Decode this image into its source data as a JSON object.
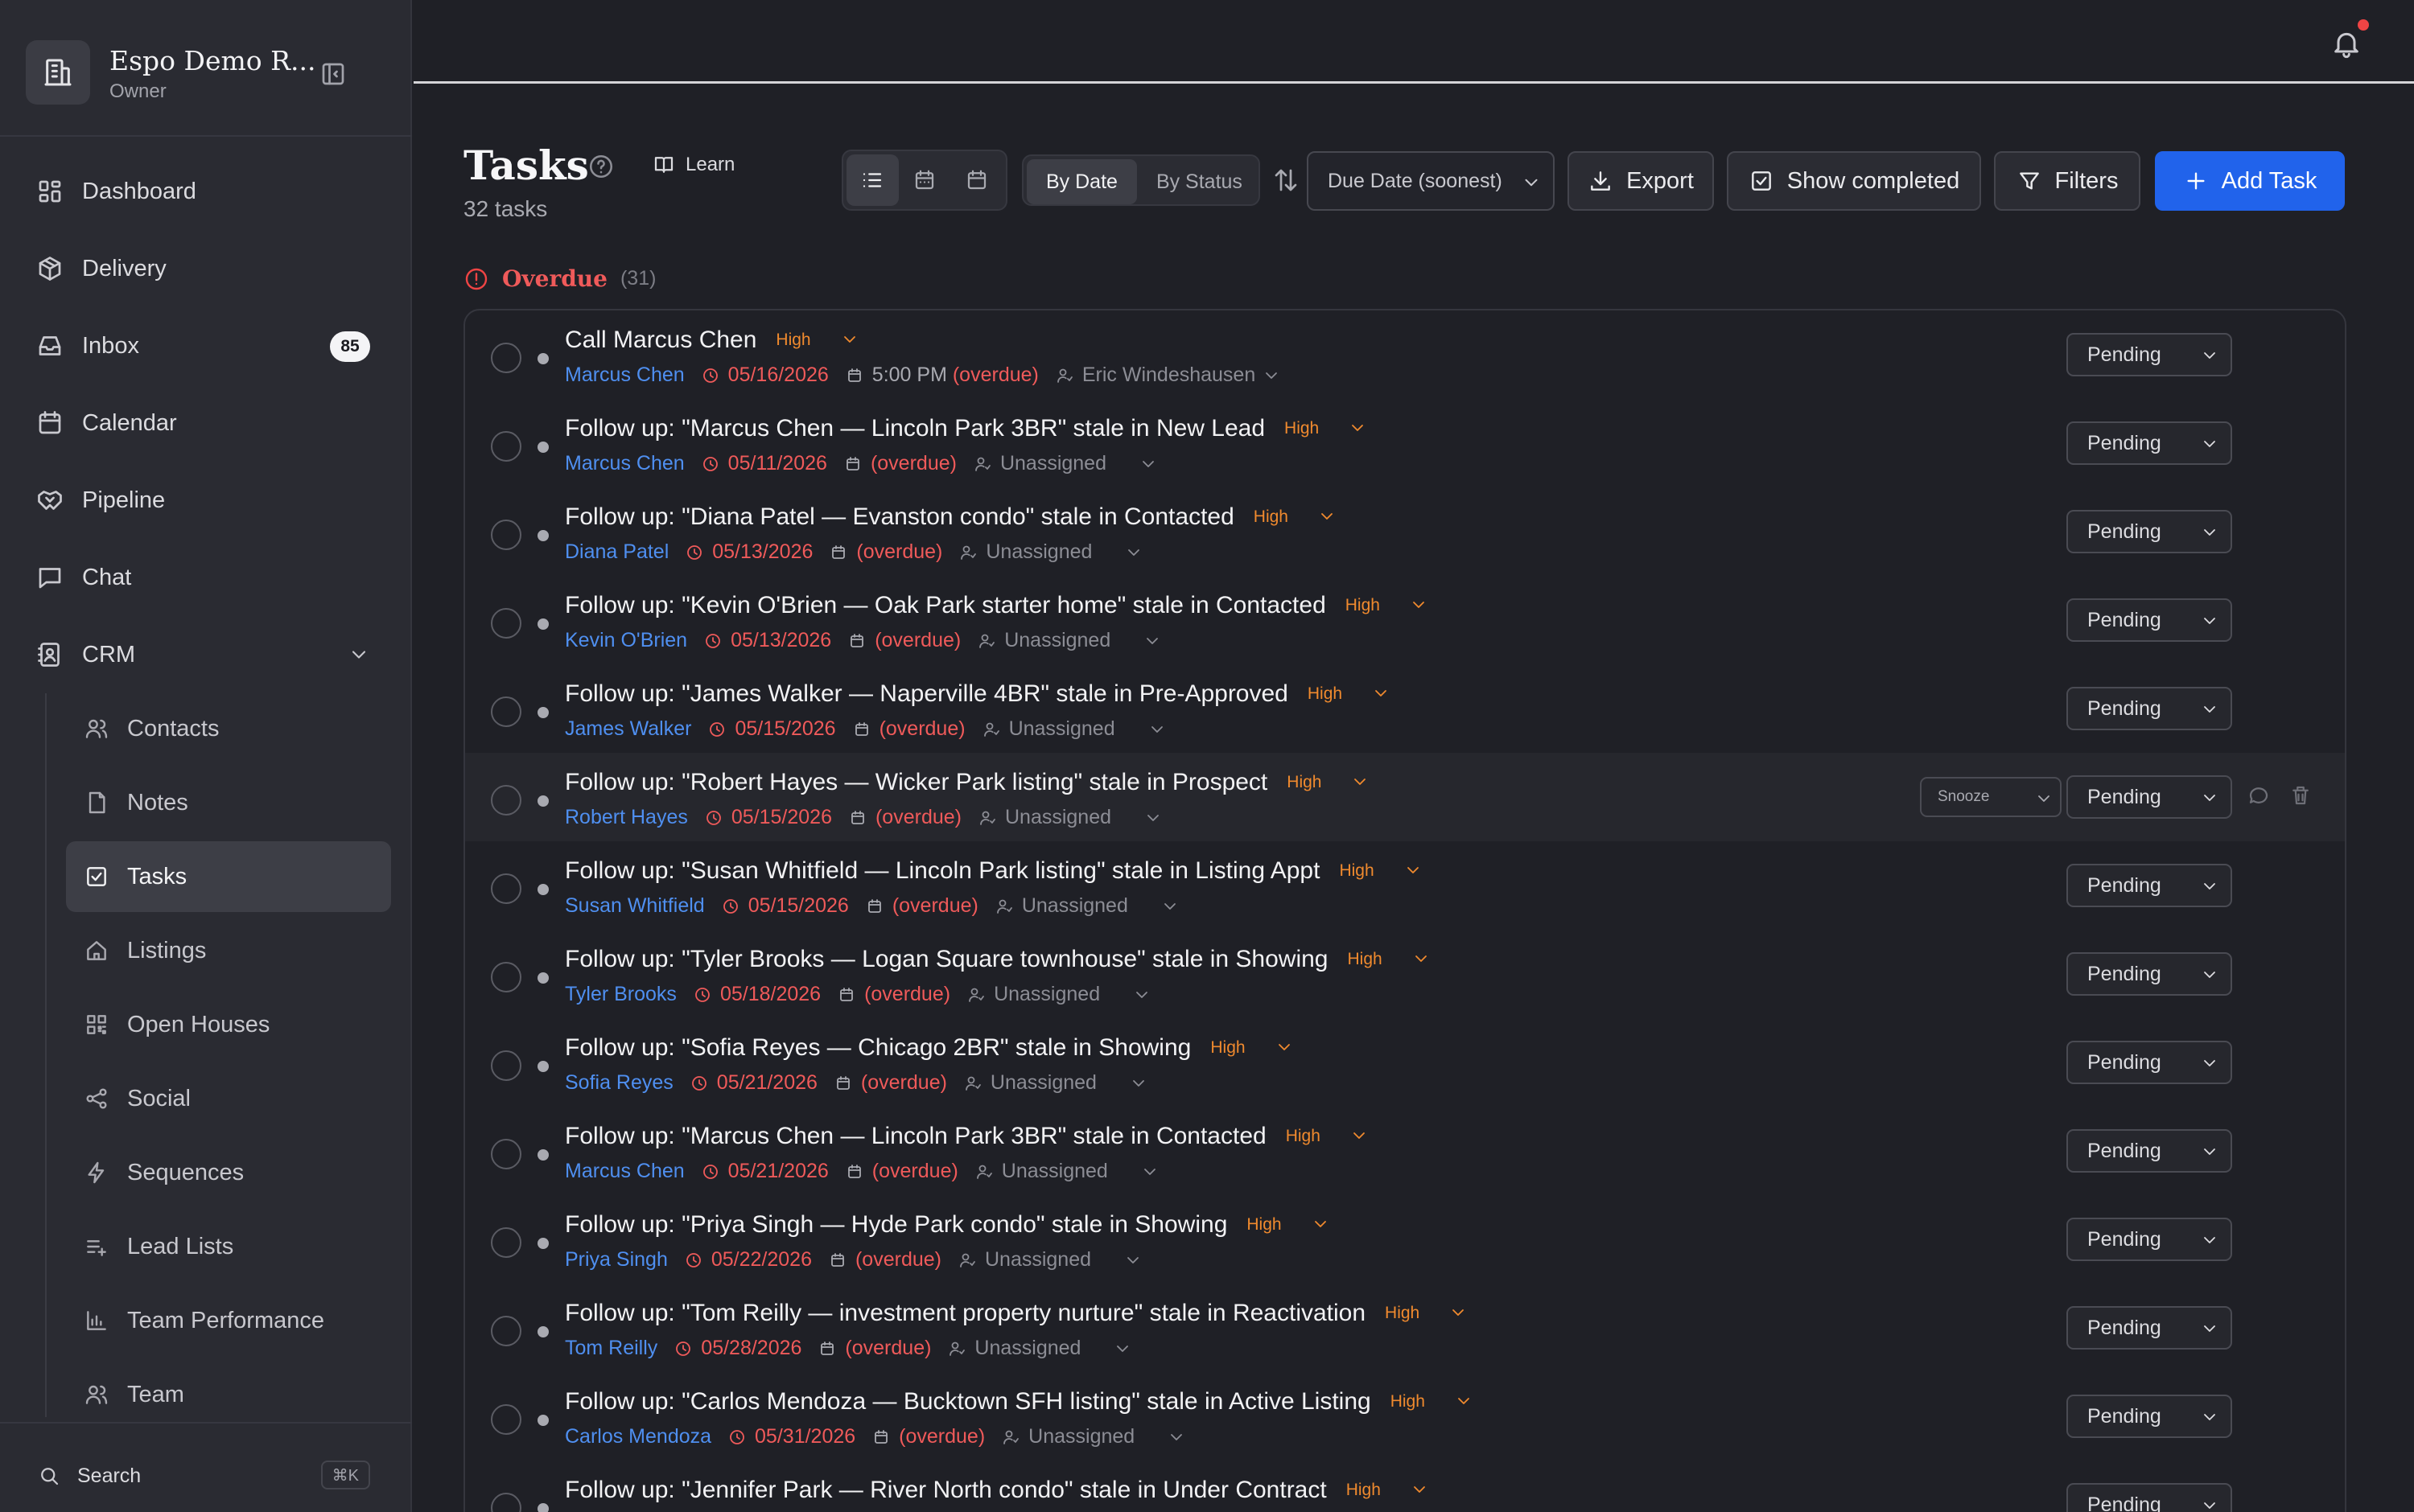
{
  "workspace": {
    "name": "Espo Demo R...",
    "role": "Owner"
  },
  "nav": [
    {
      "label": "Dashboard",
      "icon": "dashboard-icon"
    },
    {
      "label": "Delivery",
      "icon": "package-icon"
    },
    {
      "label": "Inbox",
      "icon": "inbox-icon",
      "badge": "85"
    },
    {
      "label": "Calendar",
      "icon": "calendar-icon"
    },
    {
      "label": "Pipeline",
      "icon": "handshake-icon"
    },
    {
      "label": "Chat",
      "icon": "chat-icon"
    },
    {
      "label": "CRM",
      "icon": "contact-book-icon",
      "expanded": true
    }
  ],
  "crm_items": [
    {
      "label": "Contacts",
      "icon": "users-icon"
    },
    {
      "label": "Notes",
      "icon": "note-icon"
    },
    {
      "label": "Tasks",
      "icon": "task-check-icon",
      "active": true
    },
    {
      "label": "Listings",
      "icon": "home-icon"
    },
    {
      "label": "Open Houses",
      "icon": "qr-code-icon"
    },
    {
      "label": "Social",
      "icon": "share-icon"
    },
    {
      "label": "Sequences",
      "icon": "lightning-icon"
    },
    {
      "label": "Lead Lists",
      "icon": "list-plus-icon"
    },
    {
      "label": "Team Performance",
      "icon": "bar-chart-icon"
    },
    {
      "label": "Team",
      "icon": "team-icon"
    }
  ],
  "search": {
    "label": "Search",
    "shortcut": "⌘K"
  },
  "header": {
    "title": "Tasks",
    "learn": "Learn",
    "count": "32 tasks",
    "group_by": [
      "By Date",
      "By Status"
    ],
    "sort": "Due Date (soonest)",
    "export": "Export",
    "show_completed": "Show completed",
    "filters": "Filters",
    "add": "Add Task"
  },
  "section": {
    "title": "Overdue",
    "count": "(31)"
  },
  "tasks": [
    {
      "title": "Call Marcus Chen",
      "priority": "High",
      "contact": "Marcus Chen",
      "due": "05/16/2026",
      "time": "5:00 PM",
      "overdue": "(overdue)",
      "assignee": "Eric Windeshausen",
      "status": "Pending"
    },
    {
      "title": "Follow up: \"Marcus Chen — Lincoln Park 3BR\" stale in New Lead",
      "priority": "High",
      "contact": "Marcus Chen",
      "due": "05/11/2026",
      "overdue": "(overdue)",
      "assignee": "Unassigned",
      "status": "Pending"
    },
    {
      "title": "Follow up: \"Diana Patel — Evanston condo\" stale in Contacted",
      "priority": "High",
      "contact": "Diana Patel",
      "due": "05/13/2026",
      "overdue": "(overdue)",
      "assignee": "Unassigned",
      "status": "Pending"
    },
    {
      "title": "Follow up: \"Kevin O'Brien — Oak Park starter home\" stale in Contacted",
      "priority": "High",
      "contact": "Kevin O'Brien",
      "due": "05/13/2026",
      "overdue": "(overdue)",
      "assignee": "Unassigned",
      "status": "Pending"
    },
    {
      "title": "Follow up: \"James Walker — Naperville 4BR\" stale in Pre-Approved",
      "priority": "High",
      "contact": "James Walker",
      "due": "05/15/2026",
      "overdue": "(overdue)",
      "assignee": "Unassigned",
      "status": "Pending"
    },
    {
      "title": "Follow up: \"Robert Hayes — Wicker Park listing\" stale in Prospect",
      "priority": "High",
      "contact": "Robert Hayes",
      "due": "05/15/2026",
      "overdue": "(overdue)",
      "assignee": "Unassigned",
      "status": "Pending",
      "snooze": "Snooze"
    },
    {
      "title": "Follow up: \"Susan Whitfield — Lincoln Park listing\" stale in Listing Appt",
      "priority": "High",
      "contact": "Susan Whitfield",
      "due": "05/15/2026",
      "overdue": "(overdue)",
      "assignee": "Unassigned",
      "status": "Pending"
    },
    {
      "title": "Follow up: \"Tyler Brooks — Logan Square townhouse\" stale in Showing",
      "priority": "High",
      "contact": "Tyler Brooks",
      "due": "05/18/2026",
      "overdue": "(overdue)",
      "assignee": "Unassigned",
      "status": "Pending"
    },
    {
      "title": "Follow up: \"Sofia Reyes — Chicago 2BR\" stale in Showing",
      "priority": "High",
      "contact": "Sofia Reyes",
      "due": "05/21/2026",
      "overdue": "(overdue)",
      "assignee": "Unassigned",
      "status": "Pending"
    },
    {
      "title": "Follow up: \"Marcus Chen — Lincoln Park 3BR\" stale in Contacted",
      "priority": "High",
      "contact": "Marcus Chen",
      "due": "05/21/2026",
      "overdue": "(overdue)",
      "assignee": "Unassigned",
      "status": "Pending"
    },
    {
      "title": "Follow up: \"Priya Singh — Hyde Park condo\" stale in Showing",
      "priority": "High",
      "contact": "Priya Singh",
      "due": "05/22/2026",
      "overdue": "(overdue)",
      "assignee": "Unassigned",
      "status": "Pending"
    },
    {
      "title": "Follow up: \"Tom Reilly — investment property nurture\" stale in Reactivation",
      "priority": "High",
      "contact": "Tom Reilly",
      "due": "05/28/2026",
      "overdue": "(overdue)",
      "assignee": "Unassigned",
      "status": "Pending"
    },
    {
      "title": "Follow up: \"Carlos Mendoza — Bucktown SFH listing\" stale in Active Listing",
      "priority": "High",
      "contact": "Carlos Mendoza",
      "due": "05/31/2026",
      "overdue": "(overdue)",
      "assignee": "Unassigned",
      "status": "Pending"
    },
    {
      "title": "Follow up: \"Jennifer Park — River North condo\" stale in Under Contract",
      "priority": "High",
      "contact": "",
      "due": "",
      "overdue": "",
      "assignee": "",
      "status": "Pending"
    }
  ],
  "colors": {
    "accent": "#2163eb",
    "overdue": "#ef5a5a",
    "priority": "#f08a2e",
    "contact": "#4f8ff0"
  }
}
